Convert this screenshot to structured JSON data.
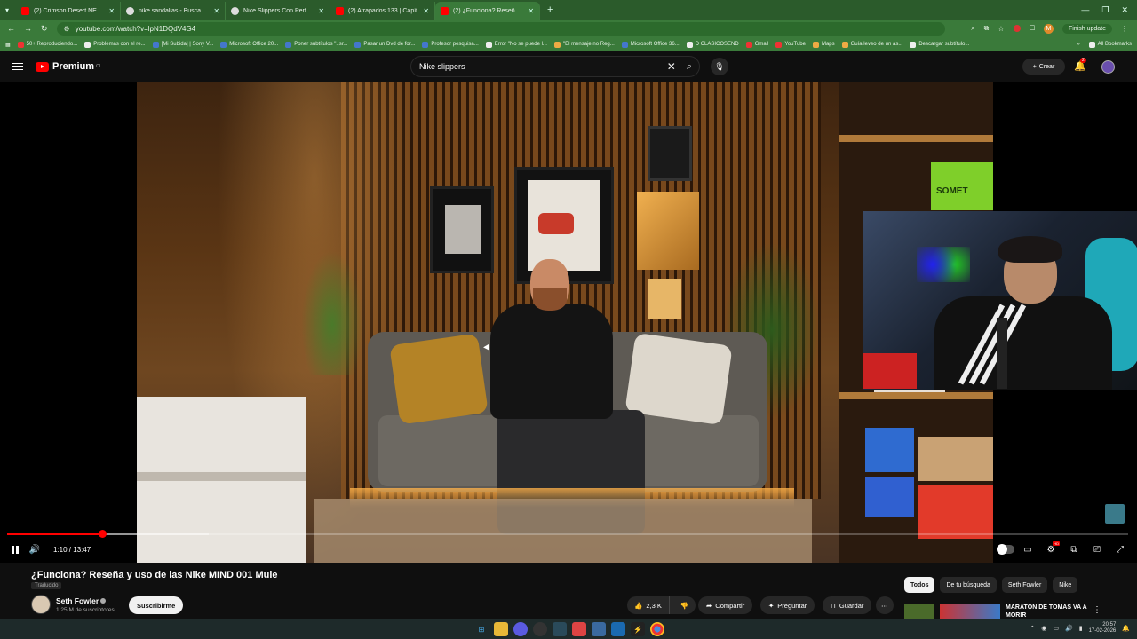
{
  "browser": {
    "tabs": [
      {
        "title": "(2) Crimson Desert NEW Game",
        "icon": "youtube-icon",
        "active": false
      },
      {
        "title": "nike sandalias - Buscar con Go",
        "icon": "google-icon",
        "active": false
      },
      {
        "title": "Nike Slippers Con Perforacione",
        "icon": "google-icon",
        "active": false
      },
      {
        "title": "(2) Atrapados 133 | Capít",
        "icon": "youtube-icon",
        "active": false
      },
      {
        "title": "(2) ¿Funciona? Reseña y uso",
        "icon": "youtube-icon",
        "active": true
      }
    ],
    "url": "youtube.com/watch?v=lpN1DQdV4G4",
    "finish_update": "Finish update",
    "profile_initial": "M",
    "bookmarks": [
      {
        "label": "50+ Reproduciendo...",
        "color": "r"
      },
      {
        "label": "Problemas con el re...",
        "color": "w"
      },
      {
        "label": "[Mi Subida] | Sony V...",
        "color": "b"
      },
      {
        "label": "Microsoft Office 20...",
        "color": "b"
      },
      {
        "label": "Poner subtítulos \"..sr...",
        "color": "b"
      },
      {
        "label": "Pasar un Dvd de for...",
        "color": "b"
      },
      {
        "label": "Profesor pesquisa...",
        "color": "b"
      },
      {
        "label": "Error \"No se puede l...",
        "color": "w"
      },
      {
        "label": "\"El mensaje no Reg...",
        "color": "y"
      },
      {
        "label": "Microsoft Office 36...",
        "color": "b"
      },
      {
        "label": "D CLASICOSEND",
        "color": "w"
      },
      {
        "label": "Gmail",
        "color": "r"
      },
      {
        "label": "YouTube",
        "color": "r"
      },
      {
        "label": "Maps",
        "color": "y"
      },
      {
        "label": "Guía leveo de un as...",
        "color": "y"
      },
      {
        "label": "Descargar subtítulo...",
        "color": "w"
      }
    ],
    "all_bookmarks": "All Bookmarks"
  },
  "youtube": {
    "logo": "Premium",
    "logo_region": "CL",
    "search_query": "Nike  slippers",
    "create_label": "Crear",
    "notif_count": "2"
  },
  "player": {
    "time": "1:10 / 13:47",
    "progress_fraction": 0.085,
    "buffered_fraction": 0.18,
    "pip_text": "SOMET"
  },
  "video": {
    "title": "¿Funciona? Reseña y uso de las Nike MIND 001 Mule",
    "translated": "Traducido",
    "channel": "Seth Fowler",
    "subscribers": "1,25 M de suscriptores",
    "subscribe_label": "Suscribirme",
    "likes": "2,3 K",
    "share_label": "Compartir",
    "ask_label": "Preguntar",
    "save_label": "Guardar"
  },
  "sidebar": {
    "chips": [
      "Todos",
      "De tu búsqueda",
      "Seth Fowler",
      "Nike"
    ],
    "rec_title": "MARATÓN DE TOMÁS VA A MORIR"
  },
  "taskbar": {
    "time": "20:57",
    "date": "17-02-2026"
  }
}
